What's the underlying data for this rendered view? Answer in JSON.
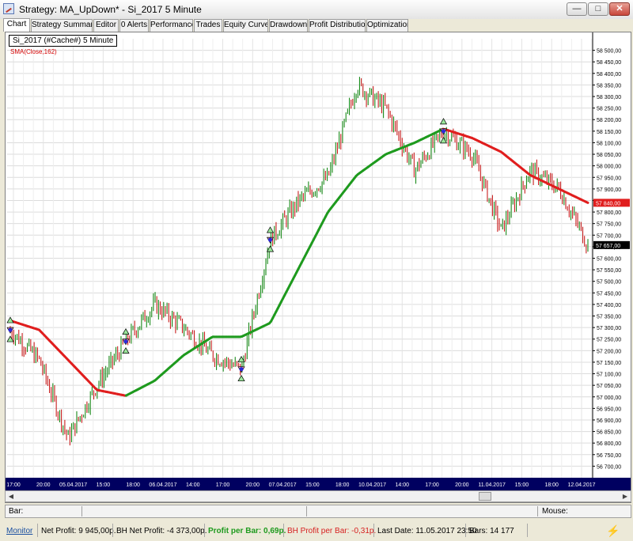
{
  "window": {
    "title": "Strategy: MA_UpDown* - Si_2017 5 Minute",
    "min_label": "—",
    "max_label": "□",
    "close_label": "✕"
  },
  "tabs": [
    {
      "label": "Chart",
      "active": true
    },
    {
      "label": "Strategy Summary"
    },
    {
      "label": "Editor"
    },
    {
      "label": "0 Alerts"
    },
    {
      "label": "Performance"
    },
    {
      "label": "Trades"
    },
    {
      "label": "Equity Curve"
    },
    {
      "label": "Drawdown"
    },
    {
      "label": "Profit Distribution"
    },
    {
      "label": "Optimization"
    }
  ],
  "chart": {
    "symbol_label": "Si_2017 (#Cache#) 5 Minute",
    "indicator_label": "SMA(Close,162)",
    "price_ticks": [
      "58 500,00",
      "58 450,00",
      "58 400,00",
      "58 350,00",
      "58 300,00",
      "58 250,00",
      "58 200,00",
      "58 150,00",
      "58 100,00",
      "58 050,00",
      "58 000,00",
      "57 950,00",
      "57 900,00",
      "57 850,00",
      "57 800,00",
      "57 750,00",
      "57 700,00",
      "57 650,00",
      "57 600,00",
      "57 550,00",
      "57 500,00",
      "57 450,00",
      "57 400,00",
      "57 350,00",
      "57 300,00",
      "57 250,00",
      "57 200,00",
      "57 150,00",
      "57 100,00",
      "57 050,00",
      "57 000,00",
      "56 950,00",
      "56 900,00",
      "56 850,00",
      "56 800,00",
      "56 750,00",
      "56 700,00"
    ],
    "price_tick_values": [
      58500,
      58450,
      58400,
      58350,
      58300,
      58250,
      58200,
      58150,
      58100,
      58050,
      58000,
      57950,
      57900,
      57850,
      57800,
      57750,
      57700,
      57650,
      57600,
      57550,
      57500,
      57450,
      57400,
      57350,
      57300,
      57250,
      57200,
      57150,
      57100,
      57050,
      57000,
      56950,
      56900,
      56850,
      56800,
      56750,
      56700
    ],
    "sma_marker_label": "57 840,00",
    "last_price_label": "57 657,00",
    "sma_marker_value": 57840,
    "last_price_value": 57657,
    "time_labels": [
      "17:00",
      "20:00",
      "05.04.2017",
      "15:00",
      "18:00",
      "06.04.2017",
      "14:00",
      "17:00",
      "20:00",
      "07.04.2017",
      "15:00",
      "18:00",
      "10.04.2017",
      "14:00",
      "17:00",
      "20:00",
      "11.04.2017",
      "15:00",
      "18:00",
      "12.04.2017"
    ],
    "colors": {
      "price_up": "#1a8a1a",
      "price_down": "#c81e1e",
      "sma_up": "#1e9a1e",
      "sma_down": "#e01e1e",
      "time_axis_bg": "#000060"
    }
  },
  "chart_data": {
    "type": "line",
    "title": "Si_2017 (#Cache#) 5 Minute",
    "xlabel": "",
    "ylabel": "",
    "ylim": [
      56650,
      58550
    ],
    "x": [
      "04.04 17:00",
      "04.04 20:00",
      "05.04 09:00",
      "05.04 15:00",
      "05.04 18:00",
      "06.04 09:00",
      "06.04 14:00",
      "06.04 17:00",
      "06.04 20:00",
      "07.04 09:00",
      "07.04 15:00",
      "07.04 18:00",
      "10.04 09:00",
      "10.04 14:00",
      "10.04 17:00",
      "10.04 20:00",
      "11.04 09:00",
      "11.04 15:00",
      "11.04 18:00",
      "12.04 09:00",
      "12.04 15:00"
    ],
    "series": [
      {
        "name": "Si_2017",
        "values": [
          57290,
          57160,
          56820,
          57050,
          57240,
          57400,
          57300,
          57180,
          57120,
          57680,
          57850,
          57950,
          58350,
          58250,
          57980,
          58150,
          58050,
          57720,
          57980,
          57900,
          57657
        ]
      },
      {
        "name": "SMA(Close,162)",
        "values": [
          57330,
          57290,
          57160,
          57030,
          57005,
          57070,
          57180,
          57260,
          57260,
          57320,
          57560,
          57800,
          57960,
          58050,
          58100,
          58160,
          58120,
          58060,
          57960,
          57900,
          57840
        ]
      }
    ]
  },
  "status": {
    "bar_label": "Bar:",
    "mouse_label": "Mouse:"
  },
  "bottom": {
    "monitor": "Monitor",
    "net_profit": "Net Profit: 9 945,00р.",
    "bh_net_profit": "BH Net Profit: -4 373,00р.",
    "profit_per_bar": "Profit per Bar: 0,69р.",
    "bh_profit_per_bar": "BH Profit per Bar: -0,31р.",
    "last_date": "Last Date: 11.05.2017 23:50",
    "bars": "Bars: 14 177"
  }
}
